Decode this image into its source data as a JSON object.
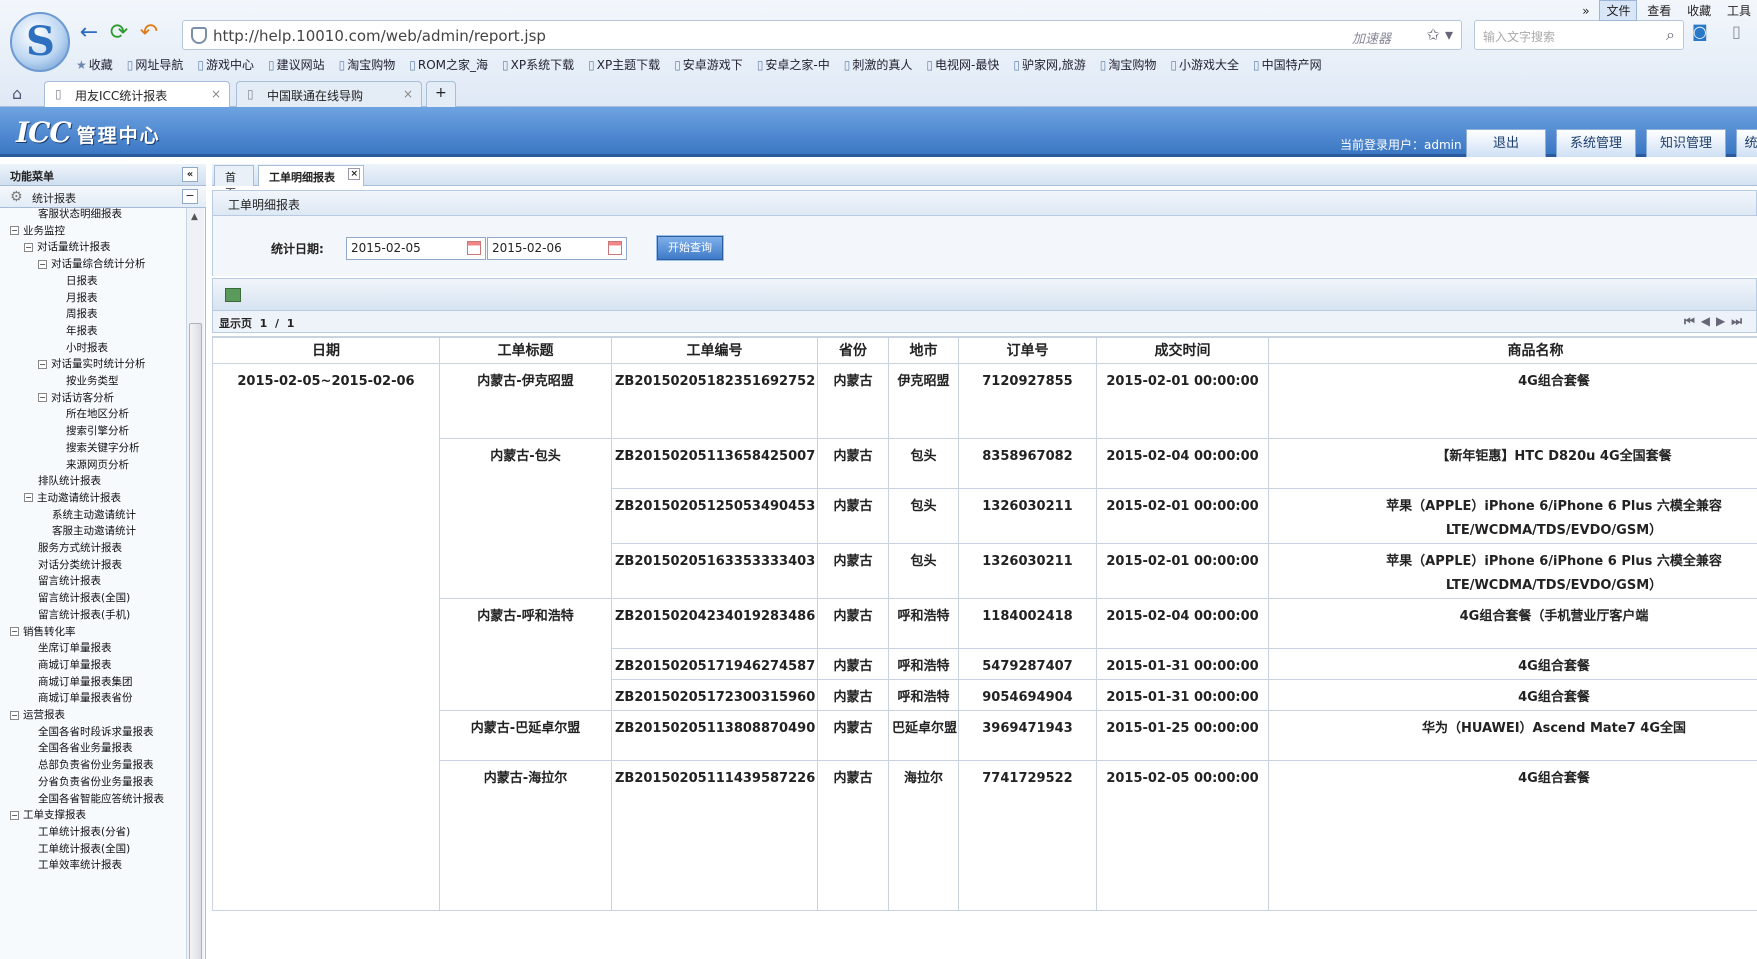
{
  "browser": {
    "menu": [
      "文件",
      "查看",
      "收藏",
      "工具"
    ],
    "url": "http://help.10010.com/web/admin/report.jsp",
    "accelerator": "加速器",
    "search_placeholder": "输入文字搜索",
    "bookmarks": [
      "收藏",
      "网址导航",
      "游戏中心",
      "建议网站",
      "淘宝购物",
      "ROM之家_海",
      "XP系统下载",
      "XP主题下载",
      "安卓游戏下",
      "安卓之家-中",
      "刺激的真人",
      "电视网-最快",
      "驴家网,旅游",
      "淘宝购物",
      "小游戏大全",
      "中国特产网"
    ],
    "tabs": [
      "用友ICC统计报表",
      "中国联通在线导购"
    ]
  },
  "app": {
    "logo": "ICC",
    "logo_sub": "管理中心",
    "current_user_label": "当前登录用户：",
    "current_user": "admin",
    "buttons": [
      "退出",
      "系统管理",
      "知识管理"
    ]
  },
  "left_panel": {
    "title": "功能菜单",
    "section": "统计报表",
    "tree": [
      {
        "label": "客服状态明细报表",
        "level": 2,
        "toggle": false
      },
      {
        "label": "业务监控",
        "level": 0,
        "toggle": true
      },
      {
        "label": "对话量统计报表",
        "level": 1,
        "toggle": true
      },
      {
        "label": "对话量综合统计分析",
        "level": 2,
        "toggle": true
      },
      {
        "label": "日报表",
        "level": 4,
        "toggle": false
      },
      {
        "label": "月报表",
        "level": 4,
        "toggle": false
      },
      {
        "label": "周报表",
        "level": 4,
        "toggle": false
      },
      {
        "label": "年报表",
        "level": 4,
        "toggle": false
      },
      {
        "label": "小时报表",
        "level": 4,
        "toggle": false
      },
      {
        "label": "对话量实时统计分析",
        "level": 2,
        "toggle": true
      },
      {
        "label": "按业务类型",
        "level": 4,
        "toggle": false
      },
      {
        "label": "对话访客分析",
        "level": 2,
        "toggle": true
      },
      {
        "label": "所在地区分析",
        "level": 4,
        "toggle": false
      },
      {
        "label": "搜索引擎分析",
        "level": 4,
        "toggle": false
      },
      {
        "label": "搜索关键字分析",
        "level": 4,
        "toggle": false
      },
      {
        "label": "来源网页分析",
        "level": 4,
        "toggle": false
      },
      {
        "label": "排队统计报表",
        "level": 2,
        "toggle": false
      },
      {
        "label": "主动邀请统计报表",
        "level": 1,
        "toggle": true
      },
      {
        "label": "系统主动邀请统计",
        "level": 3,
        "toggle": false
      },
      {
        "label": "客服主动邀请统计",
        "level": 3,
        "toggle": false
      },
      {
        "label": "服务方式统计报表",
        "level": 2,
        "toggle": false
      },
      {
        "label": "对话分类统计报表",
        "level": 2,
        "toggle": false
      },
      {
        "label": "留言统计报表",
        "level": 2,
        "toggle": false
      },
      {
        "label": "留言统计报表(全国)",
        "level": 2,
        "toggle": false
      },
      {
        "label": "留言统计报表(手机)",
        "level": 2,
        "toggle": false
      },
      {
        "label": "销售转化率",
        "level": 0,
        "toggle": true
      },
      {
        "label": "坐席订单量报表",
        "level": 2,
        "toggle": false
      },
      {
        "label": "商城订单量报表",
        "level": 2,
        "toggle": false
      },
      {
        "label": "商城订单量报表集团",
        "level": 2,
        "toggle": false
      },
      {
        "label": "商城订单量报表省份",
        "level": 2,
        "toggle": false
      },
      {
        "label": "运营报表",
        "level": 0,
        "toggle": true
      },
      {
        "label": "全国各省时段诉求量报表",
        "level": 2,
        "toggle": false
      },
      {
        "label": "全国各省业务量报表",
        "level": 2,
        "toggle": false
      },
      {
        "label": "总部负责省份业务量报表",
        "level": 2,
        "toggle": false
      },
      {
        "label": "分省负责省份业务量报表",
        "level": 2,
        "toggle": false
      },
      {
        "label": "全国各省智能应答统计报表",
        "level": 2,
        "toggle": false
      },
      {
        "label": "工单支撑报表",
        "level": 0,
        "toggle": true
      },
      {
        "label": "工单统计报表(分省)",
        "level": 2,
        "toggle": false
      },
      {
        "label": "工单统计报表(全国)",
        "level": 2,
        "toggle": false
      },
      {
        "label": "工单效率统计报表",
        "level": 2,
        "toggle": false
      }
    ]
  },
  "content": {
    "tabs": [
      "首页",
      "工单明细报表"
    ],
    "page_title": "工单明细报表",
    "filter_label": "统计日期:",
    "date_from": "2015-02-05",
    "date_to": "2015-02-06",
    "query_button": "开始查询",
    "pager_label": "显示页",
    "pager_current": "1",
    "pager_sep": "/",
    "pager_total": "1",
    "columns": [
      "日期",
      "工单标题",
      "工单编号",
      "省份",
      "地市",
      "订单号",
      "成交时间",
      "商品名称"
    ],
    "date_range": "2015-02-05~2015-02-06",
    "rows": [
      {
        "title": "内蒙古-伊克昭盟",
        "id": "ZB20150205182351692752",
        "prov": "内蒙古",
        "city": "伊克昭盟",
        "order": "7120927855",
        "time": "2015-02-01 00:00:00",
        "product": "4G组合套餐"
      },
      {
        "title": "内蒙古-包头",
        "id": "ZB20150205113658425007",
        "prov": "内蒙古",
        "city": "包头",
        "order": "8358967082",
        "time": "2015-02-04 00:00:00",
        "product": "【新年钜惠】HTC D820u 4G全国套餐"
      },
      {
        "title": "",
        "id": "ZB20150205125053490453",
        "prov": "内蒙古",
        "city": "包头",
        "order": "1326030211",
        "time": "2015-02-01 00:00:00",
        "product": "苹果（APPLE）iPhone 6/iPhone 6 Plus 六模全兼容 LTE/WCDMA/TDS/EVDO/GSM）"
      },
      {
        "title": "",
        "id": "ZB20150205163353333403",
        "prov": "内蒙古",
        "city": "包头",
        "order": "1326030211",
        "time": "2015-02-01 00:00:00",
        "product": "苹果（APPLE）iPhone 6/iPhone 6 Plus 六模全兼容 LTE/WCDMA/TDS/EVDO/GSM）"
      },
      {
        "title": "内蒙古-呼和浩特",
        "id": "ZB20150204234019283486",
        "prov": "内蒙古",
        "city": "呼和浩特",
        "order": "1184002418",
        "time": "2015-02-04 00:00:00",
        "product": "4G组合套餐（手机营业厅客户端"
      },
      {
        "title": "",
        "id": "ZB20150205171946274587",
        "prov": "内蒙古",
        "city": "呼和浩特",
        "order": "5479287407",
        "time": "2015-01-31 00:00:00",
        "product": "4G组合套餐"
      },
      {
        "title": "",
        "id": "ZB20150205172300315960",
        "prov": "内蒙古",
        "city": "呼和浩特",
        "order": "9054694904",
        "time": "2015-01-31 00:00:00",
        "product": "4G组合套餐"
      },
      {
        "title": "内蒙古-巴延卓尔盟",
        "id": "ZB20150205113808870490",
        "prov": "内蒙古",
        "city": "巴延卓尔盟",
        "order": "3969471943",
        "time": "2015-01-25 00:00:00",
        "product": "华为（HUAWEI）Ascend Mate7 4G全国"
      },
      {
        "title": "内蒙古-海拉尔",
        "id": "ZB20150205111439587226",
        "prov": "内蒙古",
        "city": "海拉尔",
        "order": "7741729522",
        "time": "2015-02-05 00:00:00",
        "product": "4G组合套餐"
      }
    ]
  }
}
